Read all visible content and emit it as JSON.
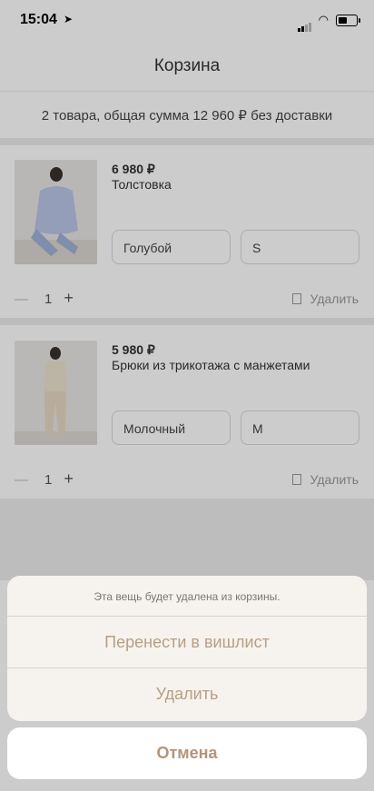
{
  "status_bar": {
    "time": "15:04",
    "location_icon": "location-arrow-icon",
    "icons": [
      "signal-icon",
      "wifi-icon",
      "battery-icon"
    ]
  },
  "header": {
    "title": "Корзина"
  },
  "summary": {
    "text": "2 товара, общая сумма 12 960 ₽ без доставки"
  },
  "items": [
    {
      "price": "6 980 ₽",
      "name": "Толстовка",
      "color": "Голубой",
      "size": "S",
      "qty": "1",
      "delete_label": "Удалить",
      "photo": "light-blue-hoodie-photo"
    },
    {
      "price": "5 980 ₽",
      "name": "Брюки из трикотажа с манжетами",
      "color": "Молочный",
      "size": "M",
      "qty": "1",
      "delete_label": "Удалить",
      "photo": "milk-knit-set-photo"
    }
  ],
  "qty_controls": {
    "minus": "—",
    "plus": "+"
  },
  "action_sheet": {
    "message": "Эта вещь будет удалена из корзины.",
    "move_to_wishlist": "Перенести в вишлист",
    "delete": "Удалить",
    "cancel": "Отмена"
  },
  "colors": {
    "accent": "#b49478",
    "text": "#333333",
    "sheet_bg": "#f6f3ef"
  }
}
